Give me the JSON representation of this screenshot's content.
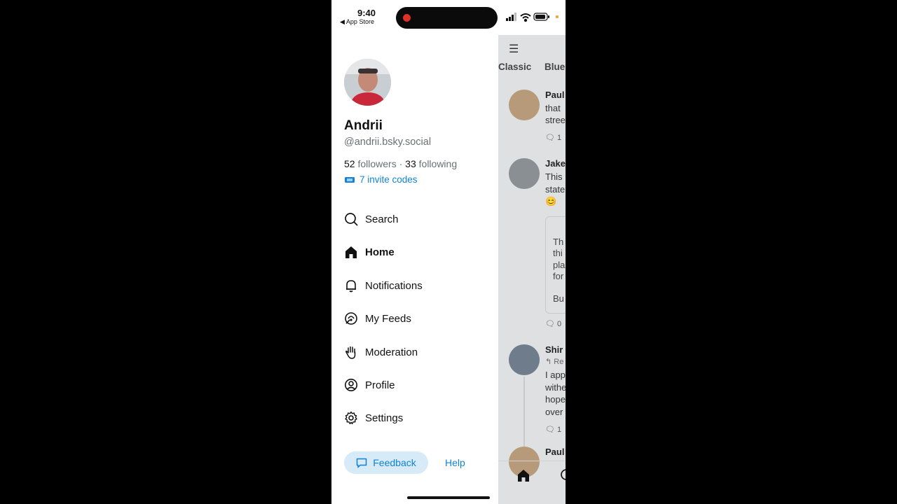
{
  "status_bar": {
    "time": "9:40",
    "back_label": "◀ App Store"
  },
  "drawer": {
    "display_name": "Andrii",
    "handle": "@andrii.bsky.social",
    "followers_count": "52",
    "followers_label": "followers",
    "separator": "·",
    "following_count": "33",
    "following_label": "following",
    "invite_codes": "7 invite codes",
    "nav": [
      {
        "label": "Search",
        "icon": "search-icon"
      },
      {
        "label": "Home",
        "icon": "home-icon"
      },
      {
        "label": "Notifications",
        "icon": "bell-icon"
      },
      {
        "label": "My Feeds",
        "icon": "feeds-icon"
      },
      {
        "label": "Moderation",
        "icon": "hand-icon"
      },
      {
        "label": "Profile",
        "icon": "profile-icon"
      },
      {
        "label": "Settings",
        "icon": "gear-icon"
      }
    ],
    "feedback_label": "Feedback",
    "help_label": "Help"
  },
  "feed": {
    "tabs": [
      "Classic",
      "Blue"
    ],
    "posts": [
      {
        "author": "Paul",
        "lines": [
          "that",
          "stree"
        ],
        "count": "1"
      },
      {
        "author": "Jake",
        "lines": [
          "This",
          "state",
          "😊"
        ],
        "quote_lines": [
          "Th",
          "thi",
          "pla",
          "for",
          "Bu"
        ],
        "count": "0"
      },
      {
        "author": "Shir",
        "reply": "↰ Re",
        "lines": [
          "I app",
          "withe",
          "hope",
          "over"
        ],
        "count": "1"
      },
      {
        "author": "Paul"
      }
    ]
  },
  "colors": {
    "accent": "#1083d6",
    "feedback_bg": "#d6eaf8",
    "overlay": "#dfe0e2"
  }
}
